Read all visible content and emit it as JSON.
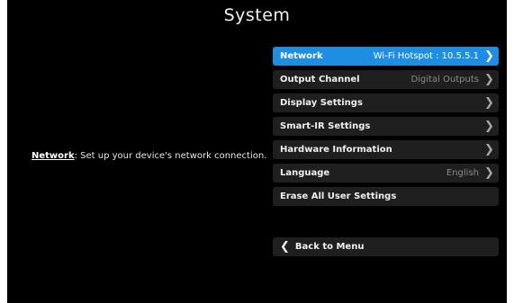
{
  "title": "System",
  "description": {
    "key": "Network",
    "text": ": Set up your device's network connection."
  },
  "menu": {
    "items": [
      {
        "label": "Network",
        "value": "Wi-Fi Hotspot : 10.5.5.1",
        "chevron": "chevron-right-icon",
        "selected": true
      },
      {
        "label": "Output Channel",
        "value": "Digital Outputs",
        "chevron": "chevron-right-icon",
        "selected": false
      },
      {
        "label": "Display Settings",
        "value": "",
        "chevron": "chevron-right-icon",
        "selected": false
      },
      {
        "label": "Smart-IR Settings",
        "value": "",
        "chevron": "chevron-right-icon",
        "selected": false
      },
      {
        "label": "Hardware Information",
        "value": "",
        "chevron": "chevron-right-icon",
        "selected": false
      },
      {
        "label": "Language",
        "value": "English",
        "chevron": "chevron-right-icon",
        "selected": false
      },
      {
        "label": "Erase All User Settings",
        "value": "",
        "chevron": "",
        "selected": false
      }
    ]
  },
  "back": {
    "label": "Back to Menu",
    "icon": "chevron-left-icon"
  },
  "colors": {
    "selected": "#1e8ee3",
    "item_bg": "#1f1f1f",
    "screen_bg": "#000000"
  }
}
